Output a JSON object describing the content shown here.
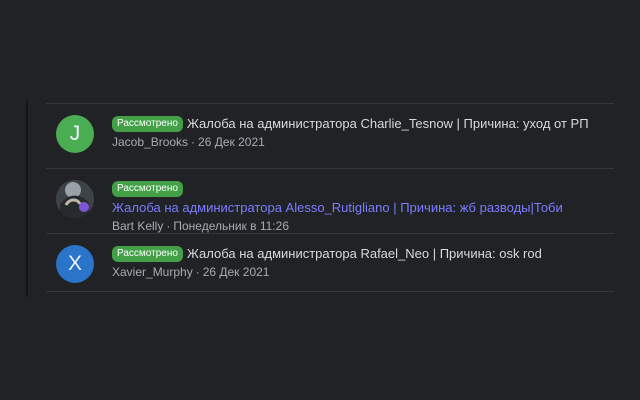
{
  "threads": [
    {
      "avatar_letter": "J",
      "avatar_color": "#4aad52",
      "status": "Рассмотрено",
      "title": "Жалоба на администратора Charlie_Tesnow | Причина: уход от РП",
      "author": "Jacob_Brooks",
      "separator": "·",
      "date": "26 Дек 2021"
    },
    {
      "avatar_letter": "",
      "status": "Рассмотрено",
      "title": "Жалоба на администратора Alesso_Rutigliano | Причина: жб разводы|Тоби",
      "author": "Bart Kelly",
      "separator": "·",
      "date": "Понедельник в 11:26"
    },
    {
      "avatar_letter": "X",
      "avatar_color": "#2a74c9",
      "status": "Рассмотрено",
      "title": "Жалоба на администратора Rafael_Neo | Причина: osk rod",
      "author": "Xavier_Murphy",
      "separator": "·",
      "date": "26 Дек 2021"
    }
  ],
  "colors": {
    "badge": "#43a047",
    "unread_title": "#7a7dff",
    "background": "#212226"
  }
}
